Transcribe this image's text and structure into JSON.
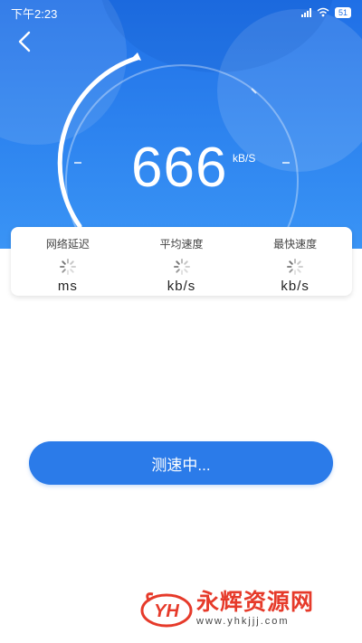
{
  "status_bar": {
    "time": "下午2:23",
    "battery": "51"
  },
  "speed": {
    "value": "666",
    "unit": "kB/S"
  },
  "metrics": [
    {
      "label": "网络延迟",
      "unit": "ms"
    },
    {
      "label": "平均速度",
      "unit": "kb/s"
    },
    {
      "label": "最快速度",
      "unit": "kb/s"
    }
  ],
  "action_button": {
    "label": "测速中..."
  },
  "watermark": {
    "title": "永辉资源网",
    "url": "www.yhkjjj.com",
    "logo": "YH"
  },
  "colors": {
    "primary": "#2b7be9",
    "header": "#1f6fe6",
    "watermark": "#e63a2a"
  },
  "icons": {
    "back": "chevron-left-icon",
    "loading": "spinner-icon",
    "wifi": "wifi-icon",
    "signal": "signal-icon",
    "battery": "battery-icon"
  }
}
